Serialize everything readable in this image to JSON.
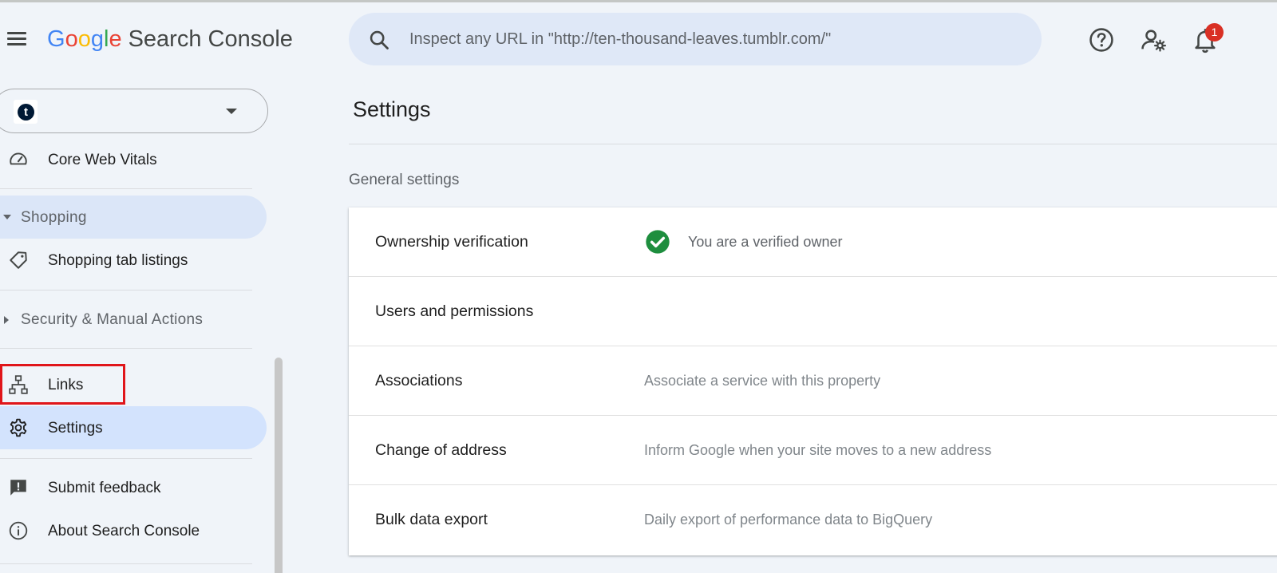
{
  "app": {
    "logo_letters": [
      "G",
      "o",
      "o",
      "g",
      "l",
      "e"
    ],
    "product_name": "Search Console"
  },
  "search": {
    "placeholder": "Inspect any URL in \"http://ten-thousand-leaves.tumblr.com/\""
  },
  "header": {
    "notification_count": "1",
    "icons": [
      "menu-icon",
      "search-icon",
      "help-icon",
      "manage-users-icon",
      "notifications-icon"
    ]
  },
  "property": {
    "favicon_letter": "t"
  },
  "sidebar": {
    "core_web_vitals": "Core Web Vitals",
    "shopping_section": "Shopping",
    "shopping_tab_listings": "Shopping tab listings",
    "security_section": "Security & Manual Actions",
    "links": "Links",
    "settings": "Settings",
    "submit_feedback": "Submit feedback",
    "about": "About Search Console"
  },
  "main": {
    "title": "Settings",
    "section_title": "General settings",
    "rows": [
      {
        "label": "Ownership verification",
        "description": "You are a verified owner"
      },
      {
        "label": "Users and permissions",
        "description": ""
      },
      {
        "label": "Associations",
        "description": "Associate a service with this property"
      },
      {
        "label": "Change of address",
        "description": "Inform Google when your site moves to a new address"
      },
      {
        "label": "Bulk data export",
        "description": "Daily export of performance data to BigQuery"
      }
    ]
  },
  "colors": {
    "accent_active": "#d3e3fd",
    "verified_green": "#1e8e3e",
    "badge_red": "#d93025",
    "highlight_red": "#e0151a"
  }
}
